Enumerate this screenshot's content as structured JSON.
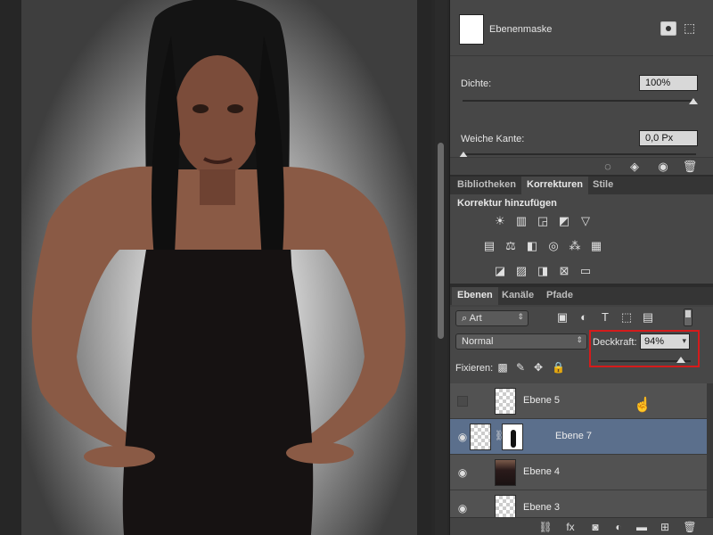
{
  "properties": {
    "mask_label": "Ebenenmaske",
    "density_label": "Dichte:",
    "density_value": "100%",
    "feather_label": "Weiche Kante:",
    "feather_value": "0,0 Px",
    "footer_icons": [
      "selection-icon",
      "apply-mask-icon",
      "visibility-icon",
      "trash-icon"
    ]
  },
  "tabs_top": [
    {
      "label": "Bibliotheken",
      "active": false
    },
    {
      "label": "Korrekturen",
      "active": true
    },
    {
      "label": "Stile",
      "active": false
    }
  ],
  "adjustments": {
    "title": "Korrektur hinzufügen",
    "icons": [
      "brightness-icon",
      "levels-icon",
      "curves-icon",
      "exposure-icon",
      "vibrance-icon",
      "hue-saturation-icon",
      "color-balance-icon",
      "black-white-icon",
      "photo-filter-icon",
      "channel-mixer-icon",
      "color-lookup-icon",
      "invert-icon",
      "posterize-icon",
      "threshold-icon",
      "selective-color-icon",
      "gradient-map-icon"
    ]
  },
  "tabs_layers": [
    {
      "label": "Ebenen",
      "active": true
    },
    {
      "label": "Kanäle",
      "active": false
    },
    {
      "label": "Pfade",
      "active": false
    }
  ],
  "layers_panel": {
    "filter_value": "Art",
    "blend_mode": "Normal",
    "opacity_label": "Deckkraft:",
    "opacity_value": "94%",
    "opacity_level": 0.94,
    "lock_label": "Fixieren:",
    "highlight_color": "#d51b1b",
    "selected_color": "#5b6f8c",
    "layers": [
      {
        "name": "Ebene 5",
        "visible": false,
        "selected": false,
        "thumb": "transparent"
      },
      {
        "name": "Ebene 7",
        "visible": true,
        "selected": true,
        "thumb": "transparent",
        "has_mask": true
      },
      {
        "name": "Ebene 4",
        "visible": true,
        "selected": false,
        "thumb": "photo"
      },
      {
        "name": "Ebene 3",
        "visible": true,
        "selected": false,
        "thumb": "transparent"
      }
    ],
    "footer_icons": [
      "link-icon",
      "fx-icon",
      "add-mask-icon",
      "adjustment-layer-icon",
      "group-folder-icon",
      "new-layer-icon",
      "delete-layer-icon"
    ]
  }
}
